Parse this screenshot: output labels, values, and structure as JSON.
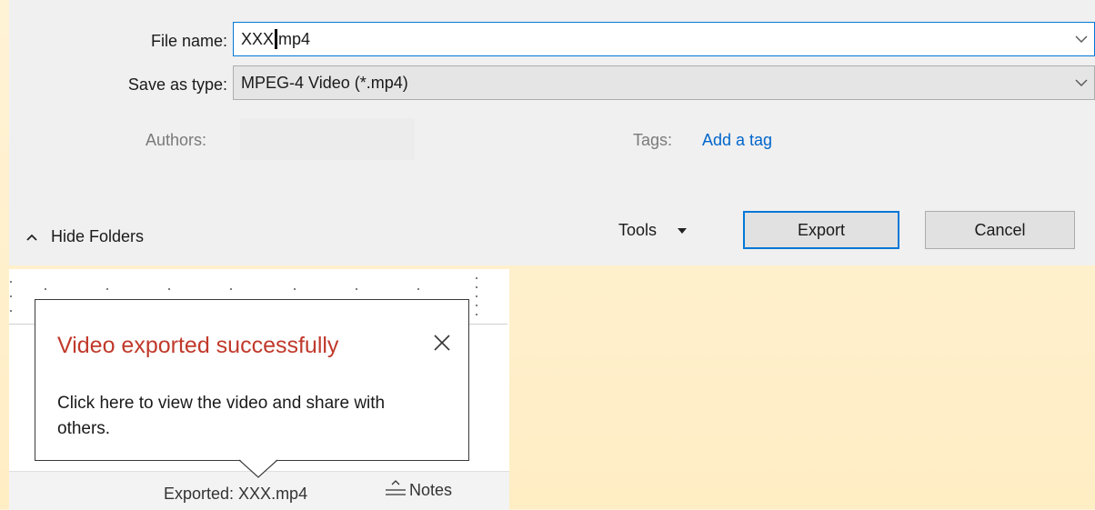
{
  "dialog": {
    "file_name_label": "File name:",
    "file_name_value_before_caret": "XXX",
    "file_name_value_after_caret": "mp4",
    "save_as_type_label": "Save as type:",
    "save_as_type_value": "MPEG-4 Video (*.mp4)",
    "authors_label": "Authors:",
    "tags_label": "Tags:",
    "add_tag_link": "Add a tag",
    "hide_folders_label": "Hide Folders",
    "tools_label": "Tools",
    "export_button": "Export",
    "cancel_button": "Cancel"
  },
  "toast": {
    "title": "Video exported successfully",
    "body": "Click here to view the video and share with others."
  },
  "status_bar": {
    "exported_text": "Exported: XXX.mp4",
    "notes_label": "Notes"
  },
  "colors": {
    "focus_border": "#0078d7",
    "link": "#0066cc",
    "toast_title": "#c0392b",
    "background": "#fff3d6"
  },
  "icons": {
    "dropdown": "chevron-down-icon",
    "hide_folders": "chevron-up-icon",
    "tools": "caret-down-icon",
    "close": "close-icon",
    "notes": "notes-icon"
  }
}
